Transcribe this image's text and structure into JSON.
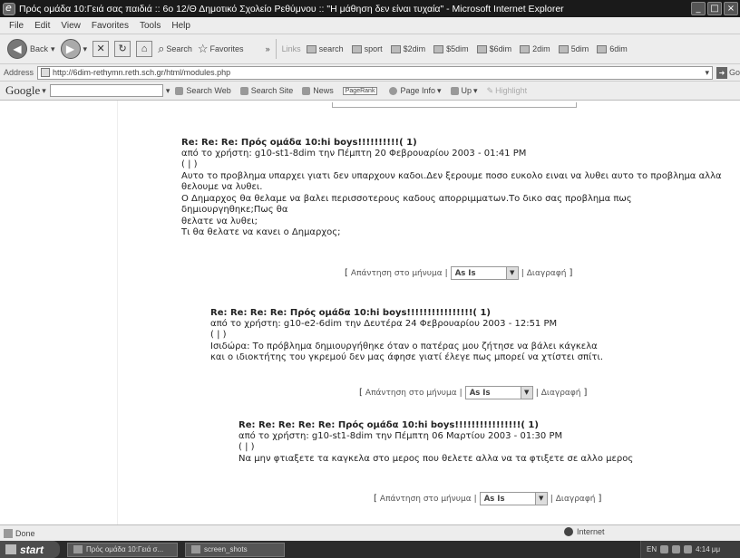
{
  "window": {
    "title": "Πρός ομάδα 10:Γειά σας παιδιά :: 6ο 12/Θ Δημοτικό Σχολείο Ρεθύμνου :: \"Η μάθηση δεν είναι τυχαία\" - Microsoft Internet Explorer",
    "controls": [
      "_",
      "□",
      "×"
    ]
  },
  "menu": [
    "File",
    "Edit",
    "View",
    "Favorites",
    "Tools",
    "Help"
  ],
  "toolbar": {
    "back_label": "Back",
    "search_label": "Search",
    "favorites_label": "Favorites",
    "chevron": "»",
    "links_label": "Links",
    "links": [
      "search",
      "sport",
      "$2dim",
      "$5dim",
      "$6dim",
      "2dim",
      "5dim",
      "6dim"
    ]
  },
  "address": {
    "label": "Address",
    "url": "http://6dim-rethymn.reth.sch.gr/html/modules.php",
    "go_label": "Go"
  },
  "google": {
    "logo": "Google",
    "search_web": "Search Web",
    "search_site": "Search Site",
    "news": "News",
    "pagerank": "PageRank",
    "page_info": "Page Info",
    "up": "Up",
    "highlight": "Highlight"
  },
  "posts": [
    {
      "subject": "Re: Re: Re: Πρός ομάδα 10:hi boys!!!!!!!!!!( 1)",
      "meta": "από το χρήστη: g10-st1-8dim την Πέμπτη 20 Φεβρουαρίου 2003 - 01:41 PM",
      "pipe": "( | )",
      "body": [
        "Αυτο το προβλημα υπαρχει γιατι δεν υπαρχουν καδοι.Δεν ξερουμε ποσο ευκολο ειναι να λυθει αυτο το προβλημα αλλα",
        "θελουμε να λυθει.",
        "Ο Δημαρχος θα θελαμε να βαλει περισσοτερους καδους απορριμματων.Το δικο σας προβλημα πως δημιουργηθηκε;Πως θα",
        "θελατε να λυθει;",
        "Τι θα θελατε να κανει ο Δημαρχος;"
      ]
    },
    {
      "subject": "Re: Re: Re: Re: Πρός ομάδα 10:hi boys!!!!!!!!!!!!!!!!( 1)",
      "meta": "από το χρήστη: g10-e2-6dim την Δευτέρα 24 Φεβρουαρίου 2003 - 12:51 PM",
      "pipe": "( | )",
      "body": [
        "Ισιδώρα: Το πρόβλημα δημιουργήθηκε όταν ο πατέρας μου ζήτησε να βάλει κάγκελα",
        "και ο ιδιοκτήτης του γκρεμού δεν μας άφησε γιατί έλεγε πως μπορεί να χτίστει σπίτι."
      ]
    },
    {
      "subject": "Re: Re: Re: Re: Re: Πρός ομάδα 10:hi boys!!!!!!!!!!!!!!!!( 1)",
      "meta": "από το χρήστη: g10-st1-8dim την Πέμπτη 06 Μαρτίου 2003 - 01:30 PM",
      "pipe": "( | )",
      "body": [
        "Να μην φτιαξετε τα καγκελα στο μερος που θελετε αλλα να τα φτιξετε σε αλλο μερος"
      ]
    }
  ],
  "actions": {
    "open_bracket": "[",
    "reply": "Απάντηση στο μήνυμα",
    "sep": "|",
    "select_value": "As Is",
    "delete": "Διαγραφή",
    "close_bracket": "]"
  },
  "status": {
    "text": "Done",
    "zone": "Internet"
  },
  "taskbar": {
    "start": "start",
    "tasks": [
      "Πρός ομάδα 10:Γειά σ...",
      "screen_shots"
    ],
    "lang": "EN",
    "clock": "4:14 μμ"
  }
}
